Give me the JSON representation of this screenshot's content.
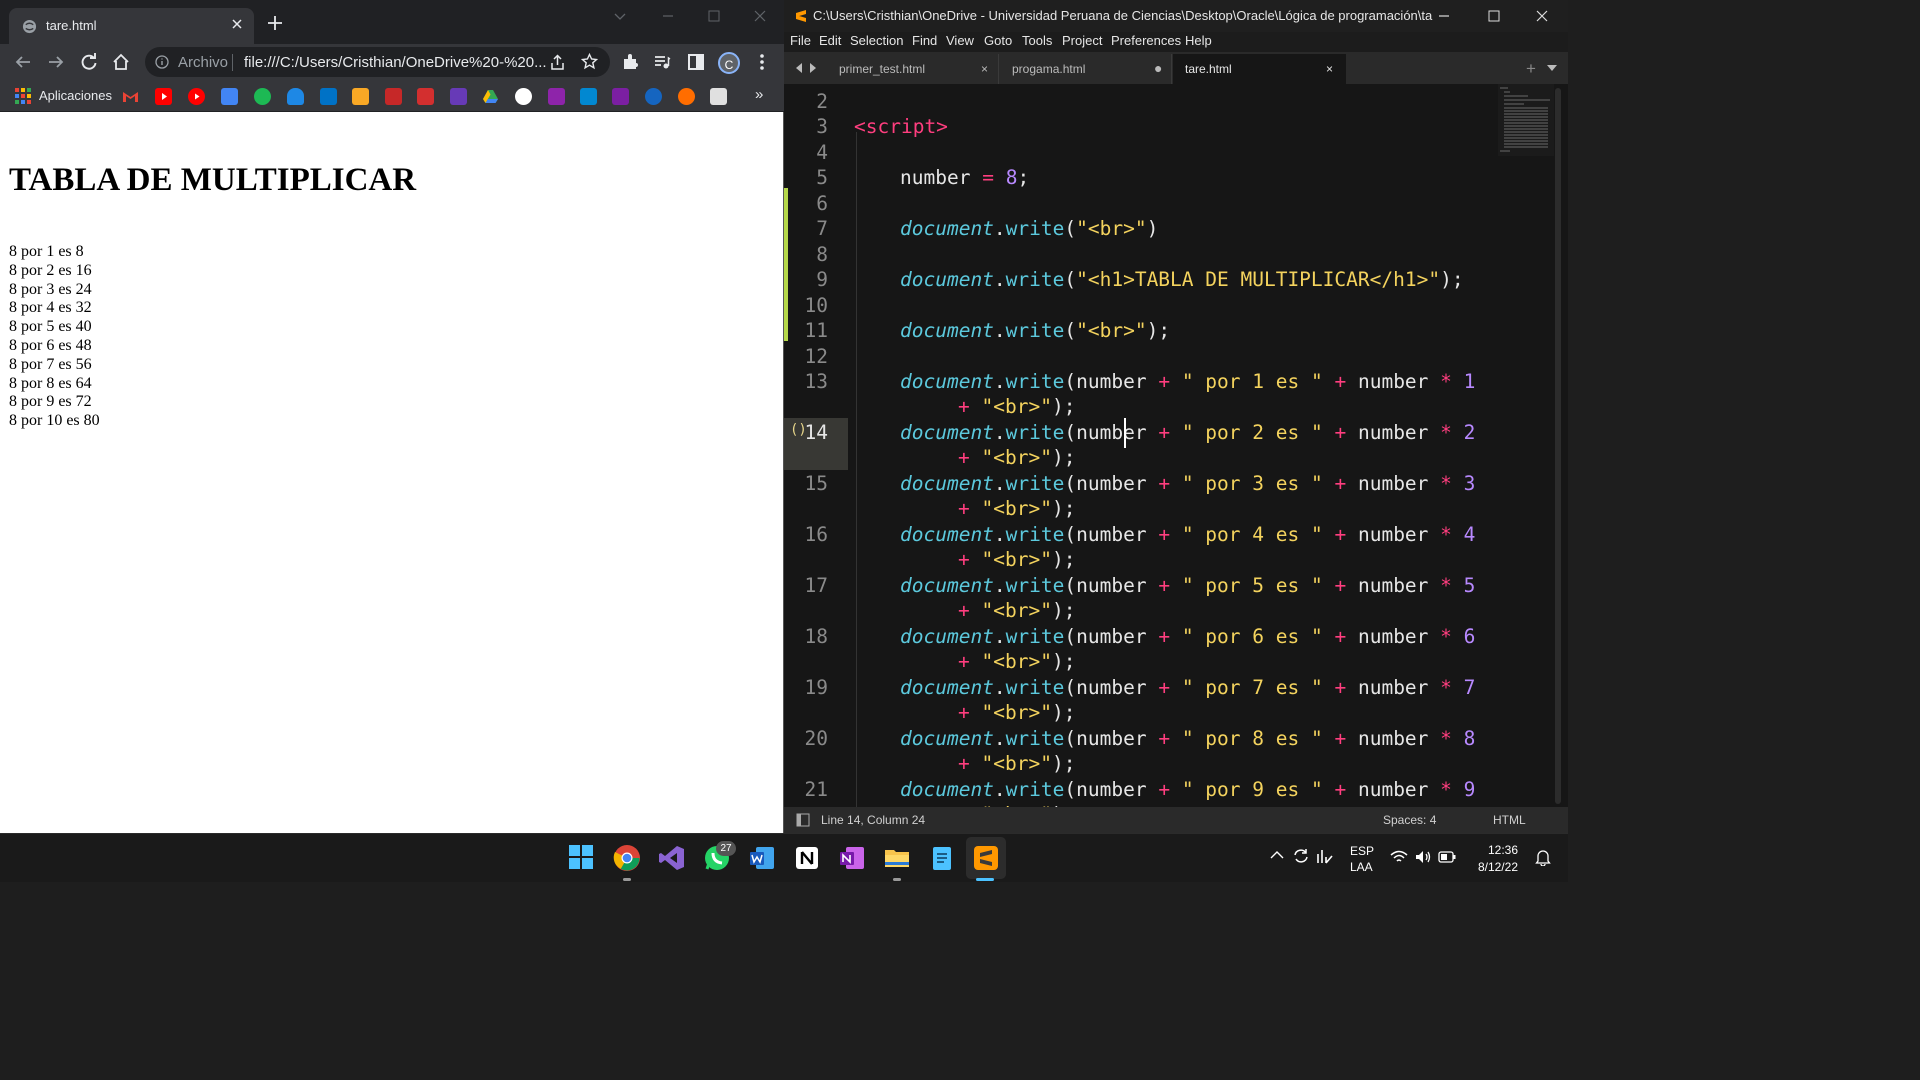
{
  "browser": {
    "tab_title": "tare.html",
    "omnibox_label": "Archivo",
    "url": "file:///C:/Users/Cristhian/OneDrive%20-%20...",
    "avatar_letter": "C",
    "bookmarks_apps_label": "Aplicaciones",
    "bookmarks_more": "»",
    "page": {
      "heading": "TABLA DE MULTIPLICAR",
      "rows": [
        "8 por 1 es 8",
        "8 por 2 es 16",
        "8 por 3 es 24",
        "8 por 4 es 32",
        "8 por 5 es 40",
        "8 por 6 es 48",
        "8 por 7 es 56",
        "8 por 8 es 64",
        "8 por 9 es 72",
        "8 por 10 es 80"
      ]
    }
  },
  "editor": {
    "window_title": "C:\\Users\\Cristhian\\OneDrive - Universidad Peruana de Ciencias\\Desktop\\Oracle\\Lógica de programación\\tare.h...",
    "menu": [
      "File",
      "Edit",
      "Selection",
      "Find",
      "View",
      "Goto",
      "Tools",
      "Project",
      "Preferences",
      "Help"
    ],
    "tabs": [
      {
        "label": "primer_test.html"
      },
      {
        "label": "progama.html"
      },
      {
        "label": "tare.html"
      }
    ],
    "line_numbers": [
      "2",
      "3",
      "4",
      "5",
      "6",
      "7",
      "8",
      "9",
      "10",
      "11",
      "12",
      "13",
      "14",
      "15",
      "16",
      "17",
      "18",
      "19",
      "20",
      "21"
    ],
    "code": {
      "script_open": "<script>",
      "number_var": "number",
      "number_value": "8",
      "doc": "document",
      "write": "write",
      "str_br": "\"<br>\"",
      "str_h1": "\"<h1>TABLA DE MULTIPLICAR</h1>\"",
      "mult_rows": [
        {
          "str": "\" por 1 es \"",
          "n": "1"
        },
        {
          "str": "\" por 2 es \"",
          "n": "2"
        },
        {
          "str": "\" por 3 es \"",
          "n": "3"
        },
        {
          "str": "\" por 4 es \"",
          "n": "4"
        },
        {
          "str": "\" por 5 es \"",
          "n": "5"
        },
        {
          "str": "\" por 6 es \"",
          "n": "6"
        },
        {
          "str": "\" por 7 es \"",
          "n": "7"
        },
        {
          "str": "\" por 8 es \"",
          "n": "8"
        },
        {
          "str": "\" por 9 es \"",
          "n": "9"
        }
      ]
    },
    "status": {
      "position": "Line 14, Column 24",
      "spaces": "Spaces: 4",
      "syntax": "HTML"
    }
  },
  "taskbar": {
    "whatsapp_badge": "27",
    "lang": "ESP",
    "layout": "LAA",
    "time": "12:36",
    "date": "8/12/22"
  }
}
